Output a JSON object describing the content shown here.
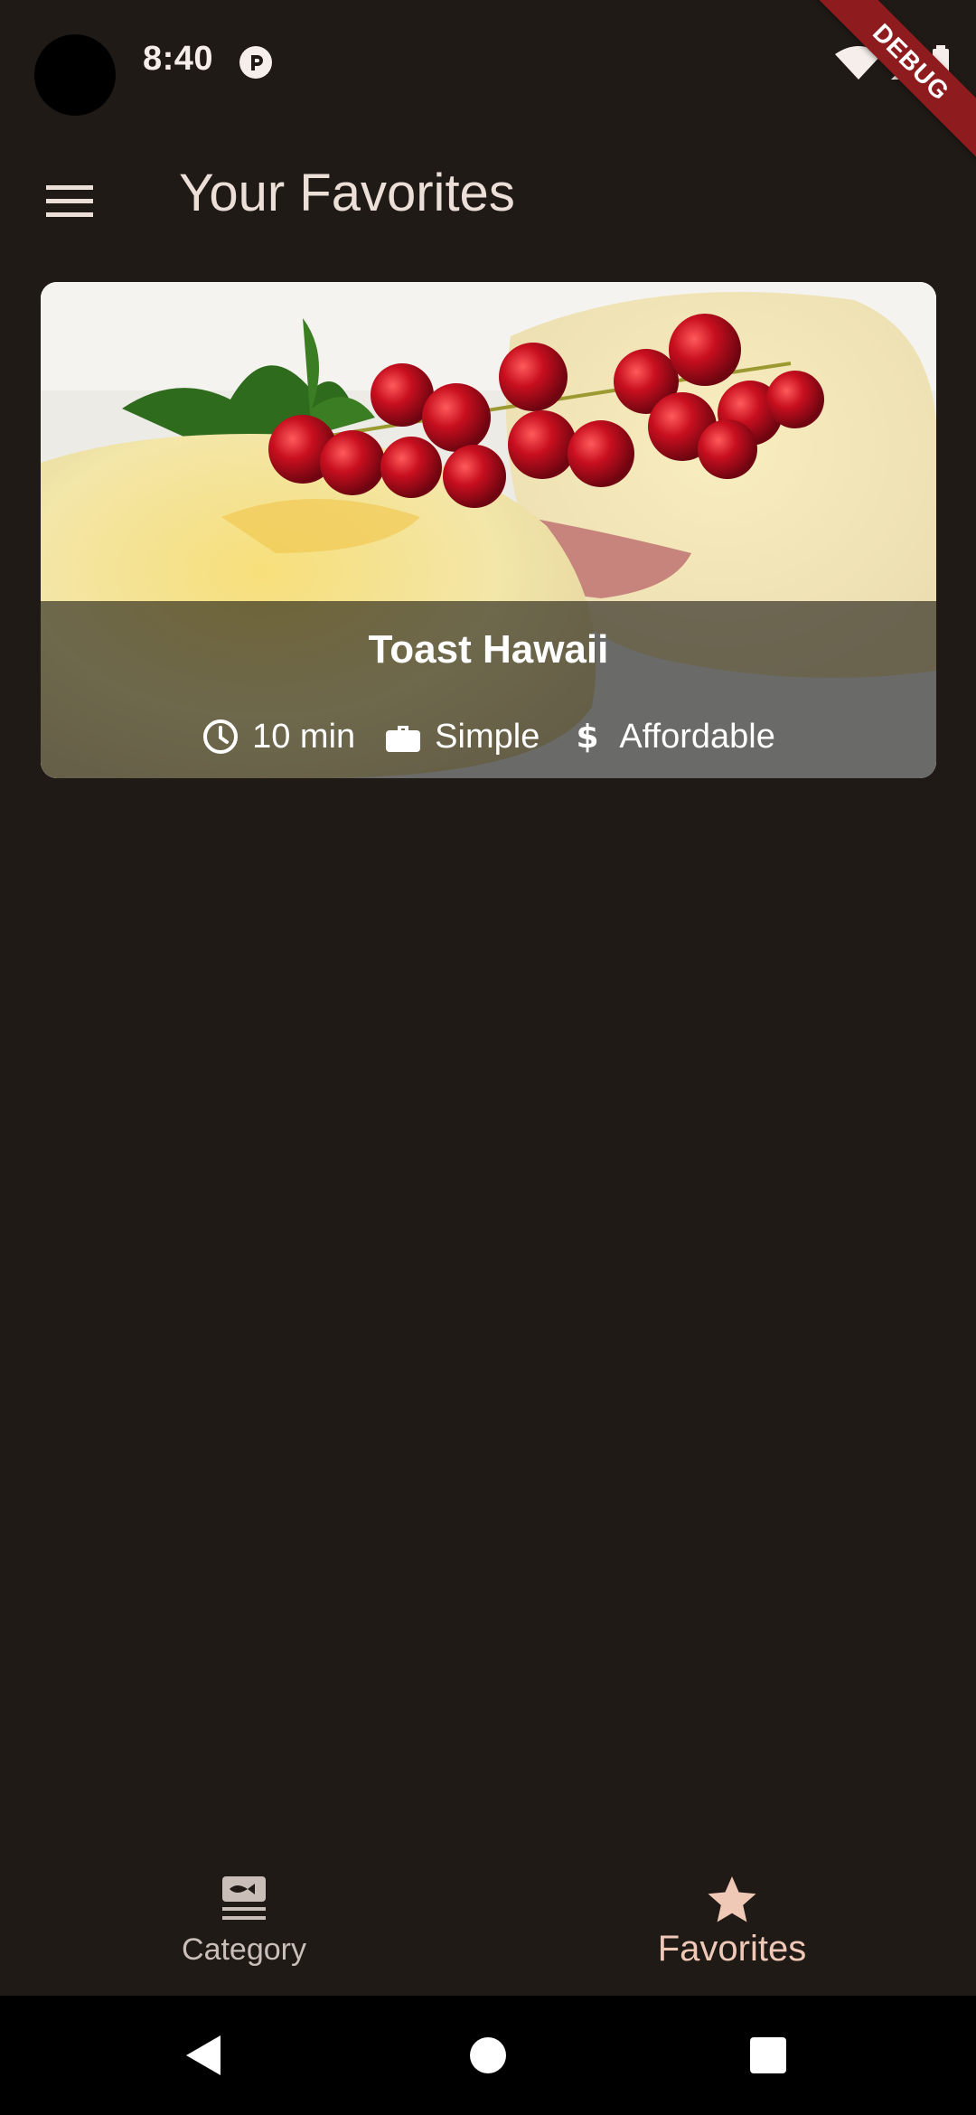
{
  "status_bar": {
    "time": "8:40",
    "debug_label": "DEBUG",
    "icons": [
      "pocket-casts-icon",
      "wifi-icon",
      "signal-icon",
      "battery-icon"
    ]
  },
  "app_bar": {
    "title": "Your Favorites",
    "menu_icon": "menu-icon"
  },
  "favorites": [
    {
      "title": "Toast Hawaii",
      "duration": "10 min",
      "complexity": "Simple",
      "affordability": "Affordable",
      "image_desc": "toast with cheese, ham, red currants and parsley"
    }
  ],
  "bottom_nav": {
    "items": [
      {
        "label": "Category",
        "icon": "set-meal-icon",
        "selected": false
      },
      {
        "label": "Favorites",
        "icon": "star-icon",
        "selected": true
      }
    ],
    "selected_color": "#f0c8b6"
  },
  "colors": {
    "background": "#201a17",
    "text": "#ecdfd8",
    "debug_banner": "#8e1b1d"
  }
}
